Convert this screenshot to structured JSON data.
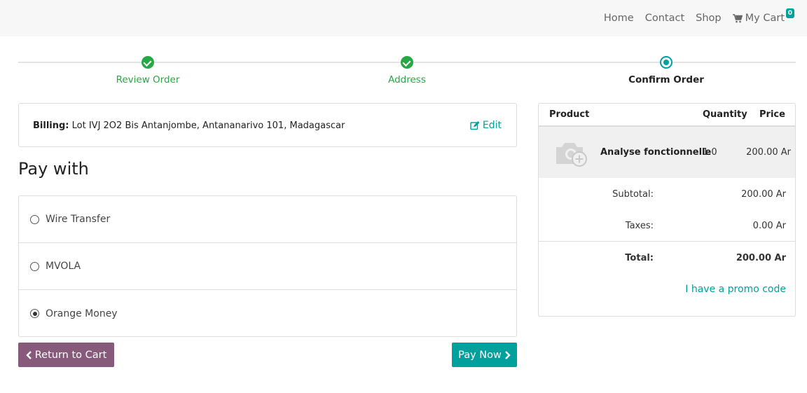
{
  "nav": {
    "items": [
      "Home",
      "Contact",
      "Shop"
    ],
    "cart_label": "My Cart",
    "cart_count": "0"
  },
  "steps": [
    {
      "label": "Review Order",
      "state": "done"
    },
    {
      "label": "Address",
      "state": "done"
    },
    {
      "label": "Confirm Order",
      "state": "active"
    }
  ],
  "billing": {
    "label": "Billing:",
    "address": "Lot IVJ 2O2 Bis Antanjombe, Antananarivo 101, Madagascar",
    "edit_label": "Edit"
  },
  "pay_with": {
    "title": "Pay with",
    "methods": [
      {
        "label": "Wire Transfer",
        "selected": false
      },
      {
        "label": "MVOLA",
        "selected": false
      },
      {
        "label": "Orange Money",
        "selected": true
      }
    ]
  },
  "buttons": {
    "return_label": "Return to Cart",
    "pay_label": "Pay Now"
  },
  "summary": {
    "headers": {
      "product": "Product",
      "quantity": "Quantity",
      "price": "Price"
    },
    "line": {
      "name": "Analyse fonctionnelle",
      "quantity": "1.0",
      "price": "200.00 Ar"
    },
    "subtotal_label": "Subtotal:",
    "subtotal": "200.00 Ar",
    "taxes_label": "Taxes:",
    "taxes": "0.00 Ar",
    "total_label": "Total:",
    "total": "200.00 Ar",
    "promo_label": "I have a promo code"
  },
  "colors": {
    "accent": "#00a09d",
    "secondary": "#875a7b",
    "success": "#28a745"
  }
}
